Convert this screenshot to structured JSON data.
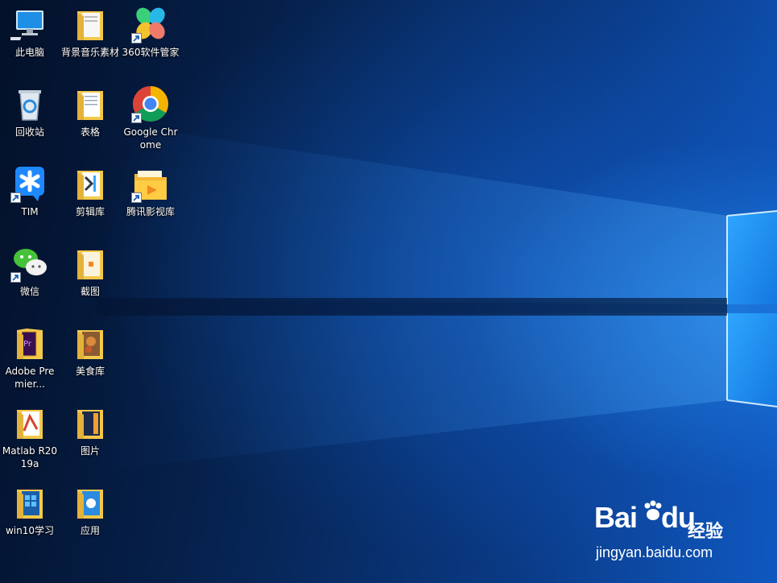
{
  "desktop": {
    "icons": [
      {
        "id": "this-pc",
        "label": "此电脑",
        "icon": "computer-icon"
      },
      {
        "id": "bg-music",
        "label": "背景音乐素材",
        "icon": "folder-icon"
      },
      {
        "id": "360",
        "label": "360软件管家",
        "icon": "360-manager-icon",
        "shortcut": true
      },
      {
        "id": "recycle",
        "label": "回收站",
        "icon": "recycle-bin-icon"
      },
      {
        "id": "biaoge",
        "label": "表格",
        "icon": "folder-icon"
      },
      {
        "id": "chrome",
        "label": "Google Chrome",
        "icon": "chrome-icon",
        "shortcut": true
      },
      {
        "id": "tim",
        "label": "TIM",
        "icon": "tim-icon",
        "shortcut": true
      },
      {
        "id": "jianji",
        "label": "剪辑库",
        "icon": "folder-icon"
      },
      {
        "id": "tencent-video",
        "label": "腾讯影视库",
        "icon": "tencent-video-icon",
        "shortcut": true
      },
      {
        "id": "wechat",
        "label": "微信",
        "icon": "wechat-icon",
        "shortcut": true
      },
      {
        "id": "jietu",
        "label": "截图",
        "icon": "folder-icon"
      },
      {
        "id": "premiere",
        "label": "Adobe Premier...",
        "icon": "folder-premiere-icon"
      },
      {
        "id": "meishi",
        "label": "美食库",
        "icon": "folder-icon"
      },
      {
        "id": "matlab",
        "label": "Matlab R2019a",
        "icon": "folder-matlab-icon"
      },
      {
        "id": "tupian",
        "label": "图片",
        "icon": "folder-icon"
      },
      {
        "id": "win10",
        "label": "win10学习",
        "icon": "folder-icon"
      },
      {
        "id": "yingyong",
        "label": "应用",
        "icon": "folder-icon"
      }
    ]
  },
  "watermark": {
    "brand": "Bai",
    "brand_tail": "du",
    "cn": "经验",
    "url": "jingyan.baidu.com"
  },
  "colors": {
    "folder": "#f4c94a",
    "folder_dark": "#d9a62b",
    "accent": "#1e88ff"
  }
}
